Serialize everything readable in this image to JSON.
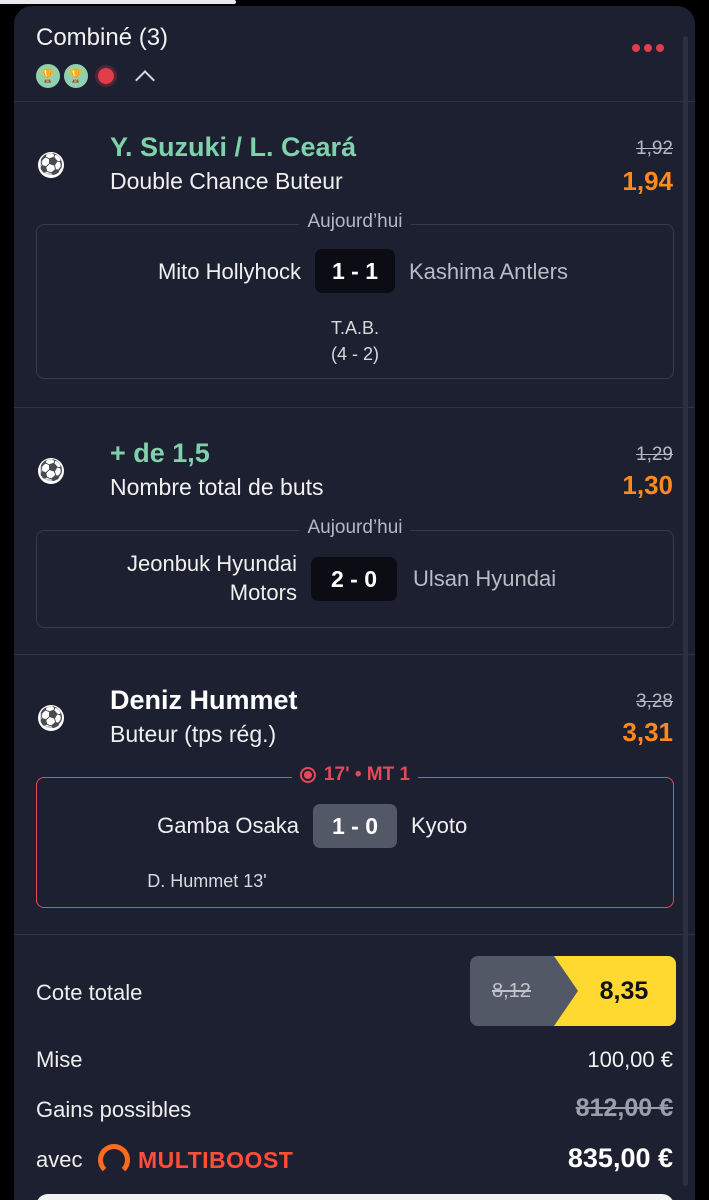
{
  "header": {
    "title": "Combiné (3)"
  },
  "selections": [
    {
      "name": "Y. Suzuki / L. Ceará",
      "market": "Double Chance Buteur",
      "odd_old": "1,92",
      "odd_new": "1,94",
      "label": "Aujourd’hui",
      "home": "Mito Hollyhock",
      "score": "1 - 1",
      "away": "Kashima Antlers",
      "note_line1": "T.A.B.",
      "note_line2": "(4 - 2)"
    },
    {
      "name": "+ de 1,5",
      "market": "Nombre total de buts",
      "odd_old": "1,29",
      "odd_new": "1,30",
      "label": "Aujourd’hui",
      "home_line1": "Jeonbuk Hyundai",
      "home_line2": "Motors",
      "score": "2 - 0",
      "away": "Ulsan Hyundai"
    },
    {
      "name": "Deniz Hummet",
      "market": "Buteur (tps rég.)",
      "odd_old": "3,28",
      "odd_new": "3,31",
      "label": "17' • MT 1",
      "home": "Gamba Osaka",
      "score": "1 - 0",
      "away": "Kyoto",
      "scorer": "D. Hummet 13'"
    }
  ],
  "totals": {
    "cote_label": "Cote totale",
    "cote_old": "8,12",
    "cote_new": "8,35",
    "mise_label": "Mise",
    "mise_value": "100,00 €",
    "gains_label": "Gains possibles",
    "gains_old": "812,00 €",
    "avec_label": "avec",
    "multiboost_label": "MULTIBOOST",
    "gains_new": "835,00 €"
  },
  "colors": {
    "background": "#1d2030",
    "selection_green": "#7fd1ac",
    "odd_orange": "#ff8a1c",
    "live_red": "#e4495a",
    "boost_yellow": "#ffd930"
  }
}
